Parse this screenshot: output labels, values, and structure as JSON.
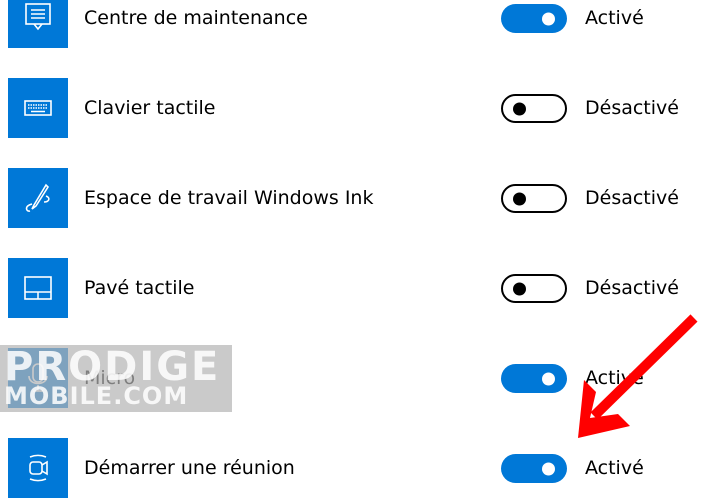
{
  "settings": [
    {
      "label": "Centre de maintenance",
      "icon": "action-center-icon",
      "on": true,
      "state": "Activé"
    },
    {
      "label": "Clavier tactile",
      "icon": "keyboard-icon",
      "on": false,
      "state": "Désactivé"
    },
    {
      "label": "Espace de travail Windows Ink",
      "icon": "windows-ink-icon",
      "on": false,
      "state": "Désactivé"
    },
    {
      "label": "Pavé tactile",
      "icon": "touchpad-icon",
      "on": false,
      "state": "Désactivé"
    },
    {
      "label": "Micro",
      "icon": "microphone-icon",
      "on": true,
      "state": "Activé"
    },
    {
      "label": "Démarrer une réunion",
      "icon": "meet-now-icon",
      "on": true,
      "state": "Activé"
    }
  ],
  "watermark": {
    "line1": "PRODIGE",
    "line2": "MOBILE.COM"
  },
  "colors": {
    "accent": "#0078d7",
    "arrow": "#ff0000"
  }
}
